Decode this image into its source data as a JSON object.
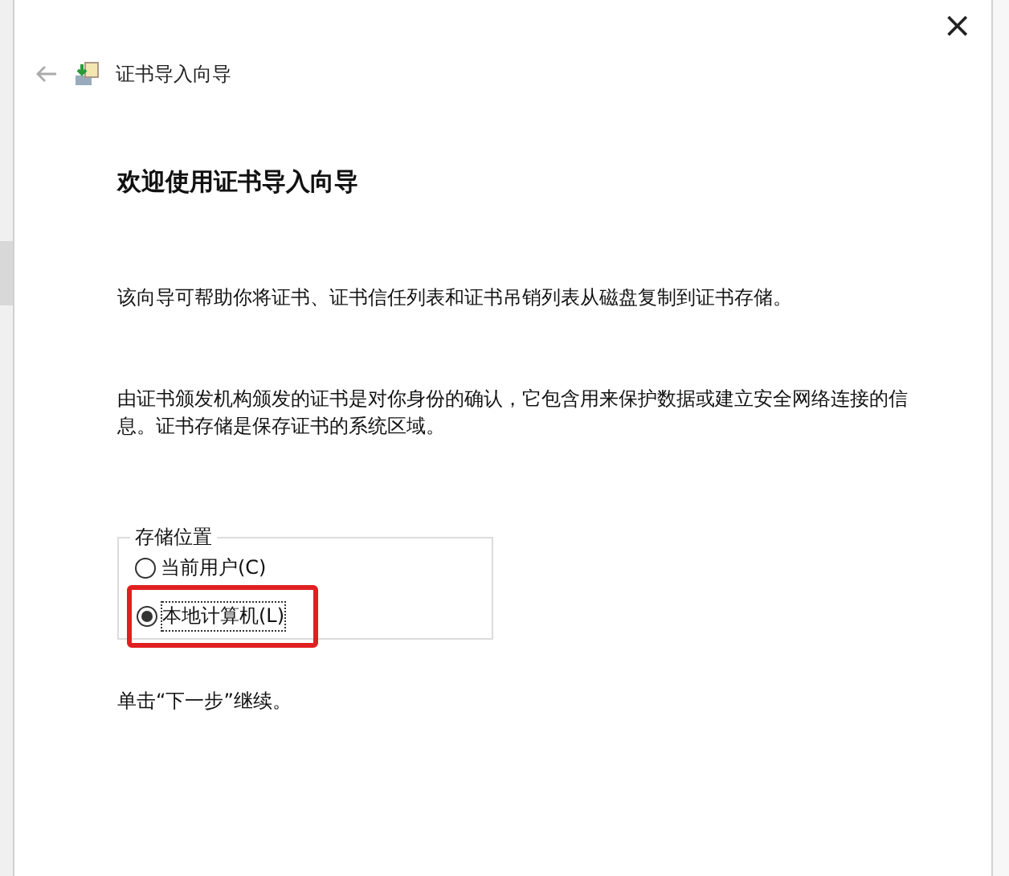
{
  "window": {
    "title": "证书导入向导",
    "close": "×"
  },
  "heading": "欢迎使用证书导入向导",
  "paragraphs": [
    "该向导可帮助你将证书、证书信任列表和证书吊销列表从磁盘复制到证书存储。",
    "由证书颁发机构颁发的证书是对你身份的确认，它包含用来保护数据或建立安全网络连接的信息。证书存储是保存证书的系统区域。"
  ],
  "store_location": {
    "legend": "存储位置",
    "options": [
      {
        "label": "当前用户(C)",
        "selected": false,
        "highlighted": false
      },
      {
        "label": "本地计算机(L)",
        "selected": true,
        "highlighted": true
      }
    ]
  },
  "footer": "单击“下一步”继续。"
}
